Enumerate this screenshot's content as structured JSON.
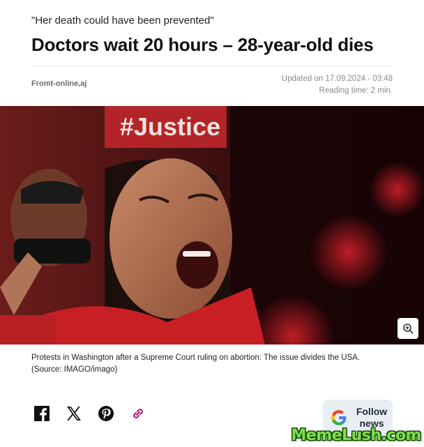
{
  "article": {
    "kicker": "\"Her death could have been prevented\"",
    "headline": "Doctors wait 20 hours – 28-year-old dies",
    "author": "Fromt-online,aj",
    "updated": "Updated on 17.09.2024 - 03:48",
    "reading_time": "Reading time: 2 min."
  },
  "image": {
    "sign_text": "#Justice",
    "caption_line1": "Protests in Washington after a Supreme Court ruling on abortion: The issue divides the USA.",
    "caption_line2": "(Source: IMAGO/imago)",
    "zoom_icon": "zoom-in-icon"
  },
  "share": {
    "icons": [
      "facebook-icon",
      "x-icon",
      "pinterest-icon",
      "link-icon"
    ]
  },
  "follow_button": {
    "line1": "Follow",
    "line2": "news",
    "icon": "google-icon"
  },
  "watermark": "MemeLush.com",
  "colors": {
    "headline": "#111111",
    "meta": "#8a8a8a",
    "follow_bg": "#e9eef2",
    "watermark": "#7ee04c"
  }
}
